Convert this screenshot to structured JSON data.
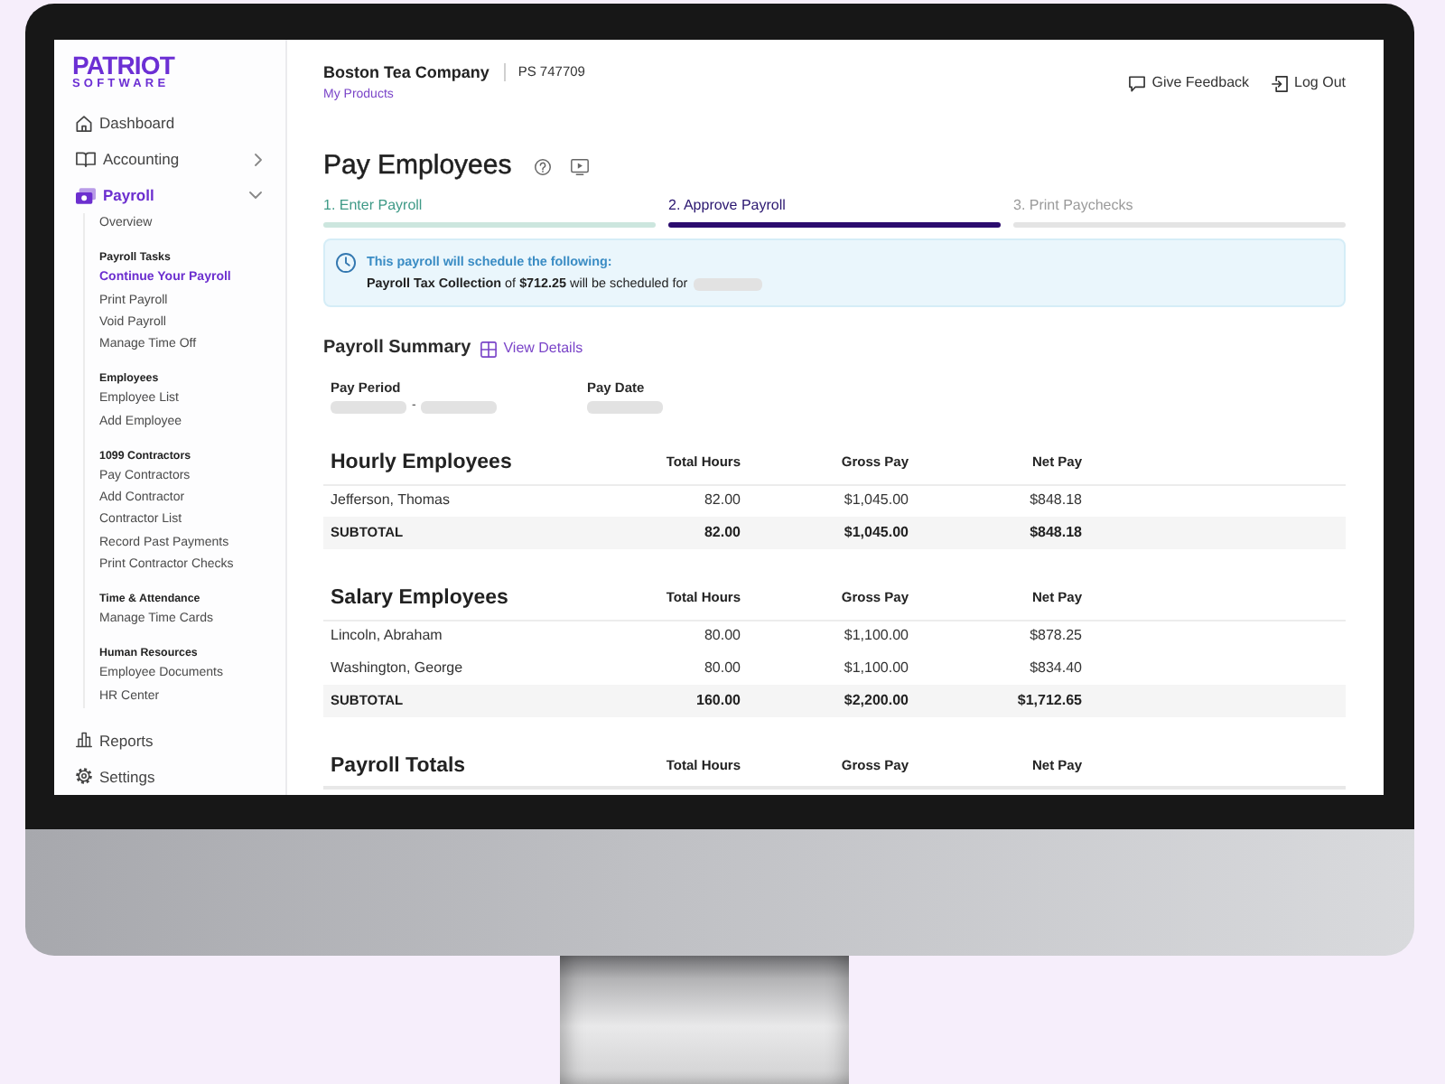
{
  "logo": {
    "line_1": "PATRIOT",
    "line_2": "SOFTWARE"
  },
  "sidebar": {
    "items": [
      {
        "label": "Dashboard",
        "kind": "link",
        "selected": false
      },
      {
        "label": "Accounting",
        "kind": "menu",
        "selected": false,
        "expanded": false
      },
      {
        "label": "Payroll",
        "kind": "menu",
        "selected": true,
        "expanded": true,
        "submenu": {
          "items": [
            {
              "label": "Overview",
              "selected": false
            }
          ],
          "groups": [
            {
              "heading": "Payroll Tasks",
              "items": [
                {
                  "label": "Continue Your Payroll",
                  "selected": true
                },
                {
                  "label": "Print Payroll",
                  "selected": false
                },
                {
                  "label": "Void Payroll",
                  "selected": false
                },
                {
                  "label": "Manage Time Off",
                  "selected": false
                }
              ]
            },
            {
              "heading": "Employees",
              "items": [
                {
                  "label": "Employee List",
                  "selected": false
                },
                {
                  "label": "Add Employee",
                  "selected": false
                }
              ]
            },
            {
              "heading": "1099 Contractors",
              "items": [
                {
                  "label": "Pay Contractors",
                  "selected": false
                },
                {
                  "label": "Add Contractor",
                  "selected": false
                },
                {
                  "label": "Contractor List",
                  "selected": false
                },
                {
                  "label": "Record Past Payments",
                  "selected": false
                },
                {
                  "label": "Print Contractor Checks",
                  "selected": false
                }
              ]
            },
            {
              "heading": "Time & Attendance",
              "items": [
                {
                  "label": "Manage Time Cards",
                  "selected": false
                }
              ]
            },
            {
              "heading": "Human Resources",
              "items": [
                {
                  "label": "Employee Documents",
                  "selected": false
                },
                {
                  "label": "HR Center",
                  "selected": false
                }
              ]
            }
          ]
        }
      },
      {
        "label": "Reports",
        "kind": "link",
        "selected": false
      },
      {
        "label": "Settings",
        "kind": "link",
        "selected": false
      }
    ]
  },
  "header": {
    "company": "Boston Tea Company",
    "account": "PS 747709",
    "link": "My Products",
    "actions": [
      {
        "label": "Give Feedback"
      },
      {
        "label": "Log Out"
      }
    ]
  },
  "page": {
    "title": "Pay Employees"
  },
  "steps": [
    {
      "label": "1. Enter Payroll",
      "completed": true,
      "selected": false
    },
    {
      "label": "2. Approve Payroll",
      "completed": false,
      "selected": true
    },
    {
      "label": "3. Print Paychecks",
      "completed": false,
      "selected": false
    }
  ],
  "alert": {
    "title": "This payroll will schedule the following:",
    "message_parts": [
      {
        "kind": "text",
        "text": "**Payroll Tax Collection** of **$712.25** will be scheduled for"
      },
      {
        "kind": "redacted"
      }
    ]
  },
  "summary": {
    "title": "Payroll Summary",
    "link": "View Details",
    "fields": [
      {
        "label": "Pay Period",
        "parts": [
          {
            "kind": "redacted"
          },
          {
            "kind": "text",
            "text": "-"
          },
          {
            "kind": "redacted"
          }
        ]
      },
      {
        "label": "Pay Date",
        "parts": [
          {
            "kind": "redacted"
          }
        ]
      }
    ]
  },
  "sections": [
    {
      "title": "Hourly Employees",
      "columns": [
        "Total Hours",
        "Gross Pay",
        "Net Pay"
      ],
      "rows": [
        {
          "name": "Jefferson, Thomas",
          "values": [
            "82.00",
            "$1,045.00",
            "$848.18"
          ]
        }
      ],
      "subtotal": {
        "label": "SUBTOTAL",
        "values": [
          "82.00",
          "$1,045.00",
          "$848.18"
        ]
      }
    },
    {
      "title": "Salary Employees",
      "columns": [
        "Total Hours",
        "Gross Pay",
        "Net Pay"
      ],
      "rows": [
        {
          "name": "Lincoln, Abraham",
          "values": [
            "80.00",
            "$1,100.00",
            "$878.25"
          ]
        },
        {
          "name": "Washington, George",
          "values": [
            "80.00",
            "$1,100.00",
            "$834.40"
          ]
        }
      ],
      "subtotal": {
        "label": "SUBTOTAL",
        "values": [
          "160.00",
          "$2,200.00",
          "$1,712.65"
        ]
      }
    },
    {
      "title": "Payroll Totals",
      "columns": [
        "Total Hours",
        "Gross Pay",
        "Net Pay"
      ]
    }
  ]
}
